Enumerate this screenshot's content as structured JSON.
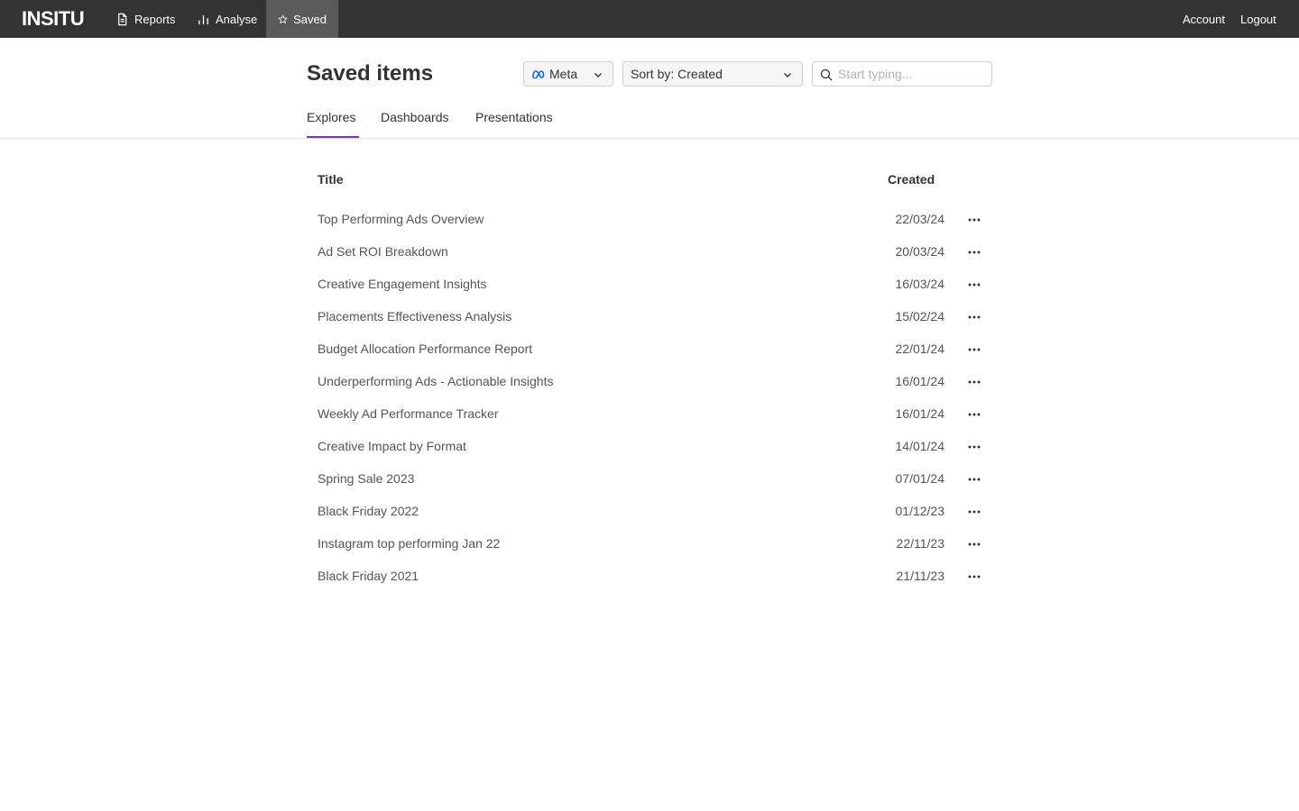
{
  "app": {
    "logo": "INSITU"
  },
  "nav": {
    "reports": "Reports",
    "analyse": "Analyse",
    "saved": "Saved",
    "account": "Account",
    "logout": "Logout"
  },
  "header": {
    "title": "Saved items",
    "platform_selected": "Meta",
    "sort_selected": "Sort by: Created",
    "search_placeholder": "Start typing..."
  },
  "tabs": [
    {
      "label": "Explores",
      "active": true
    },
    {
      "label": "Dashboards",
      "active": false
    },
    {
      "label": "Presentations",
      "active": false
    }
  ],
  "table": {
    "columns": {
      "title": "Title",
      "created": "Created"
    },
    "rows": [
      {
        "title": "Top Performing Ads Overview",
        "created": "22/03/24"
      },
      {
        "title": "Ad Set ROI Breakdown",
        "created": "20/03/24"
      },
      {
        "title": "Creative Engagement Insights",
        "created": "16/03/24"
      },
      {
        "title": "Placements Effectiveness Analysis",
        "created": "15/02/24"
      },
      {
        "title": "Budget Allocation Performance Report",
        "created": "22/01/24"
      },
      {
        "title": "Underperforming Ads - Actionable Insights",
        "created": "16/01/24"
      },
      {
        "title": "Weekly Ad Performance Tracker",
        "created": "16/01/24"
      },
      {
        "title": "Creative Impact by Format",
        "created": "14/01/24"
      },
      {
        "title": "Spring Sale 2023",
        "created": "07/01/24"
      },
      {
        "title": "Black Friday 2022",
        "created": "01/12/23"
      },
      {
        "title": "Instagram top performing Jan 22",
        "created": "22/11/23"
      },
      {
        "title": "Black Friday 2021",
        "created": "21/11/23"
      }
    ]
  },
  "colors": {
    "topbar": "#333333",
    "active_nav": "#5a5a5a",
    "tab_accent": "#7b2fd6",
    "meta_blue": "#0866ff"
  }
}
